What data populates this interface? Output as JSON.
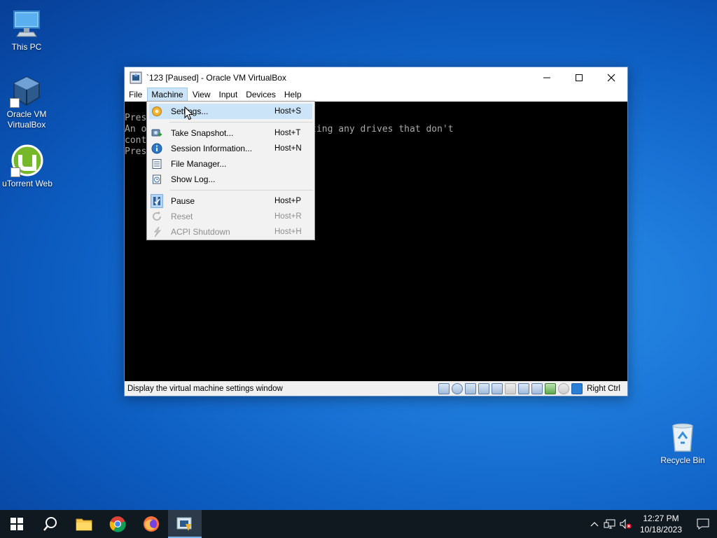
{
  "desktop": {
    "icons": [
      {
        "label": "This PC"
      },
      {
        "label": "Oracle VM\nVirtualBox"
      },
      {
        "label": "uTorrent Web"
      },
      {
        "label": "Recycle Bin"
      }
    ]
  },
  "window": {
    "title": "`123 [Paused] - Oracle VM VirtualBox",
    "menu": [
      "File",
      "Machine",
      "View",
      "Input",
      "Devices",
      "Help"
    ],
    "active_menu": "Machine",
    "screen_lines": [
      "Pres             or DVD.....",
      "An o             nd. Try disconnecting any drives that don't",
      "cont",
      "Pres"
    ],
    "status_text": "Display the virtual machine settings window",
    "host_key": "Right Ctrl"
  },
  "machine_menu": {
    "items": [
      {
        "label": "Settings...",
        "shortcut": "Host+S",
        "icon": "gear-icon",
        "enabled": true,
        "highlighted": true
      },
      {
        "label": "Take Snapshot...",
        "shortcut": "Host+T",
        "icon": "snapshot-icon",
        "enabled": true
      },
      {
        "label": "Session Information...",
        "shortcut": "Host+N",
        "icon": "info-icon",
        "enabled": true
      },
      {
        "label": "File Manager...",
        "shortcut": "",
        "icon": "file-manager-icon",
        "enabled": true
      },
      {
        "label": "Show Log...",
        "shortcut": "",
        "icon": "log-icon",
        "enabled": true
      },
      {
        "label": "Pause",
        "shortcut": "Host+P",
        "icon": "pause-icon",
        "enabled": true,
        "checked": true
      },
      {
        "label": "Reset",
        "shortcut": "Host+R",
        "icon": "reset-icon",
        "enabled": false
      },
      {
        "label": "ACPI Shutdown",
        "shortcut": "Host+H",
        "icon": "acpi-shutdown-icon",
        "enabled": false
      }
    ]
  },
  "taskbar": {
    "apps": [
      "start-icon",
      "search-icon",
      "file-explorer-icon",
      "chrome-icon",
      "firefox-icon",
      "virtualbox-icon"
    ],
    "time": "12:27 PM",
    "date": "10/18/2023"
  },
  "colors": {
    "menu_highlight": "#cce4f7",
    "desktop_blue": "#1a74d6",
    "taskbar": "#101820"
  }
}
